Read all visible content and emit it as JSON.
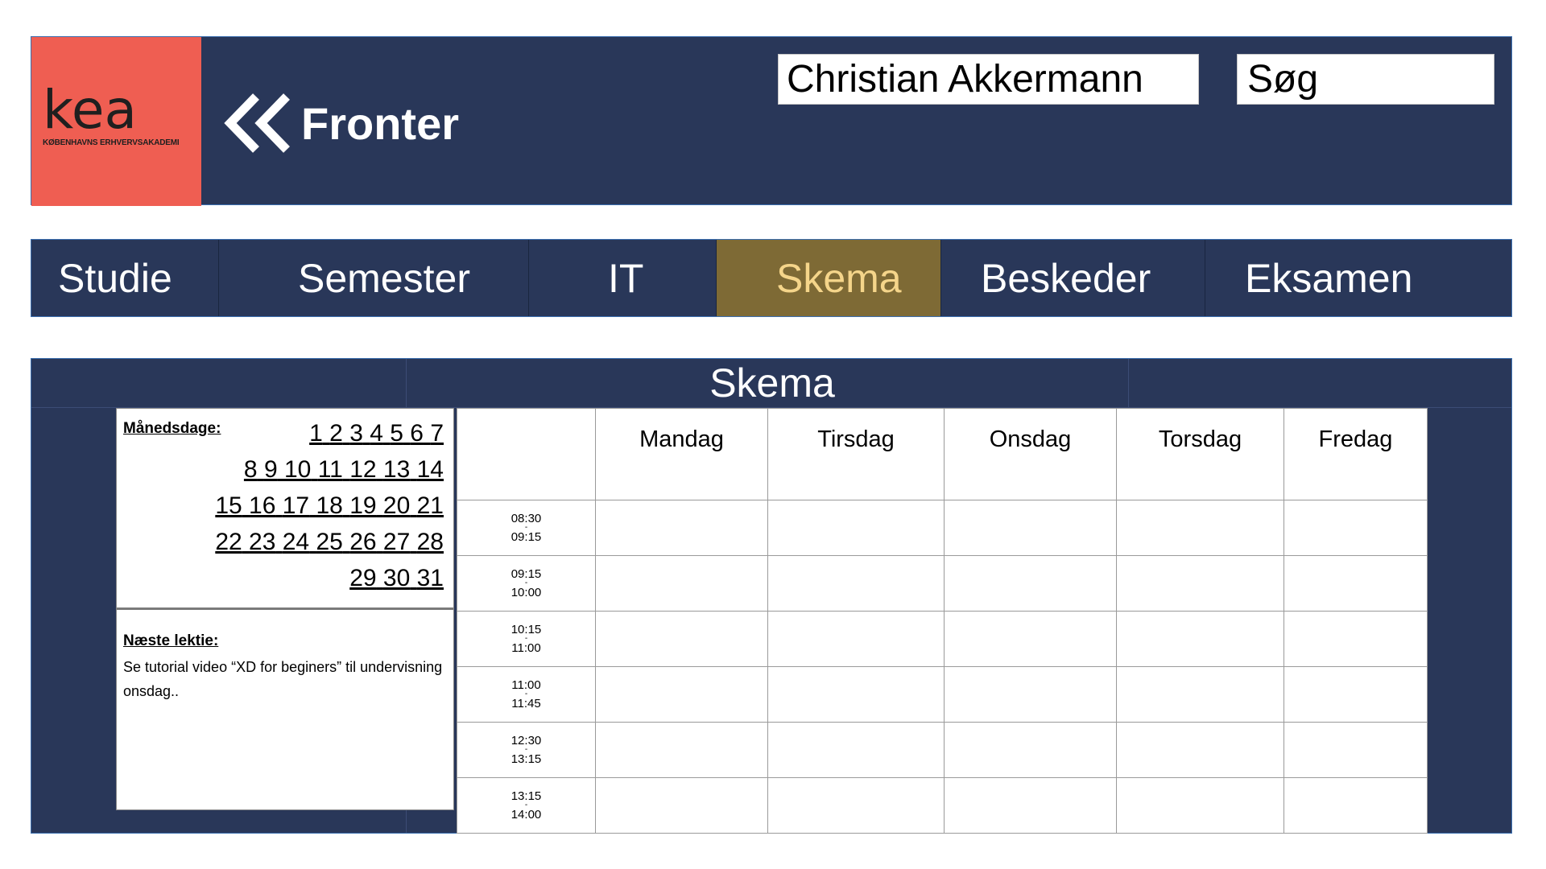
{
  "header": {
    "logo_word": "kea",
    "logo_subtitle": "KØBENHAVNS ERHVERVSAKADEMI",
    "app_name": "Fronter",
    "user_name": "Christian Akkermann",
    "search_placeholder": "Søg"
  },
  "nav": {
    "items": [
      {
        "label": "Studie"
      },
      {
        "label": "Semester"
      },
      {
        "label": "IT"
      },
      {
        "label": "Skema",
        "active": true
      },
      {
        "label": "Beskeder"
      },
      {
        "label": "Eksamen"
      }
    ]
  },
  "panel": {
    "title": "Skema",
    "calendar": {
      "label": "Månedsdage:",
      "rows": [
        [
          "1",
          "2",
          "3",
          "4",
          "5",
          "6",
          "7"
        ],
        [
          "8",
          "9",
          "10",
          "11",
          "12",
          "13",
          "14"
        ],
        [
          "15",
          "16",
          "17",
          "18",
          "19",
          "20",
          "21"
        ],
        [
          "22",
          "23",
          "24",
          "25",
          "26",
          "27",
          "28"
        ],
        [
          "29",
          "30",
          "31"
        ]
      ]
    },
    "next_lesson": {
      "title": "Næste lektie:",
      "text": "Se tutorial video “XD for beginers” til undervisning onsdag.."
    },
    "schedule": {
      "days": [
        "Mandag",
        "Tirsdag",
        "Onsdag",
        "Torsdag",
        "Fredag"
      ],
      "slots": [
        {
          "start": "08:30",
          "sep": "-",
          "end": "09:15"
        },
        {
          "start": "09:15",
          "sep": "-",
          "end": "10:00"
        },
        {
          "start": "10:15",
          "sep": "-",
          "end": "11:00"
        },
        {
          "start": "11:00",
          "sep": "-",
          "end": "11:45"
        },
        {
          "start": "12:30",
          "sep": "-",
          "end": "13:15"
        },
        {
          "start": "13:15",
          "sep": "-",
          "end": "14:00"
        }
      ]
    }
  },
  "colors": {
    "navy": "#293759",
    "logo_red": "#ef5e52",
    "active_tab_bg": "#7e6a35",
    "active_tab_text": "#f5d58a"
  }
}
